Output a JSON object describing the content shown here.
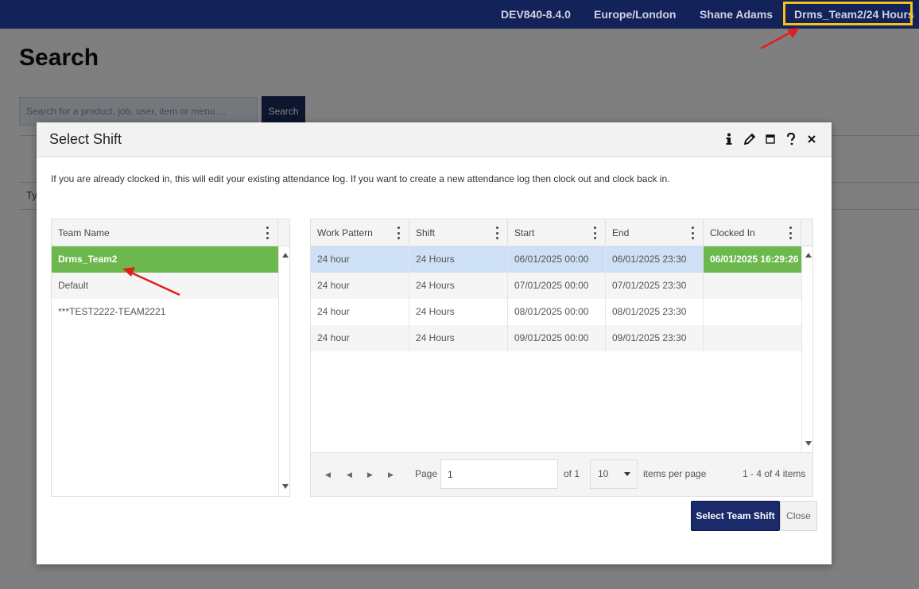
{
  "topbar": {
    "version": "DEV840-8.4.0",
    "timezone": "Europe/London",
    "user": "Shane Adams",
    "team_shift": "Drms_Team2/24 Hours"
  },
  "page": {
    "title": "Search",
    "search_placeholder": "Search for a product, job, user, item or menu ...",
    "search_button": "Search",
    "bg_fragment": "Ty"
  },
  "modal": {
    "title": "Select Shift",
    "info": "If you are already clocked in, this will edit your existing attendance log.  If you want to create a new attendance log then clock out and clock back in.",
    "icons": [
      "info-icon",
      "pencil-icon",
      "maximize-icon",
      "help-icon",
      "close-icon"
    ]
  },
  "team_grid": {
    "header": "Team Name",
    "rows": [
      "Drms_Team2",
      "Default",
      "***TEST2222-TEAM2221"
    ],
    "selected_index": 0
  },
  "shift_grid": {
    "headers": [
      "Work Pattern",
      "Shift",
      "Start",
      "End",
      "Clocked In"
    ],
    "rows": [
      [
        "24 hour",
        "24 Hours",
        "06/01/2025 00:00",
        "06/01/2025 23:30",
        "06/01/2025 16:29:26"
      ],
      [
        "24 hour",
        "24 Hours",
        "07/01/2025 00:00",
        "07/01/2025 23:30",
        ""
      ],
      [
        "24 hour",
        "24 Hours",
        "08/01/2025 00:00",
        "08/01/2025 23:30",
        ""
      ],
      [
        "24 hour",
        "24 Hours",
        "09/01/2025 00:00",
        "09/01/2025 23:30",
        ""
      ]
    ]
  },
  "pager": {
    "page_label": "Page",
    "page_value": "1",
    "of_label": "of 1",
    "page_size": "10",
    "items_per_page": "items per page",
    "summary": "1 - 4 of 4 items"
  },
  "buttons": {
    "select": "Select Team Shift",
    "close": "Close"
  },
  "colors": {
    "navy": "#14225a",
    "highlight": "#f4c21b",
    "selected_green": "#6cb84e",
    "selected_blue": "#cde0f5",
    "arrow_red": "#e02020"
  }
}
